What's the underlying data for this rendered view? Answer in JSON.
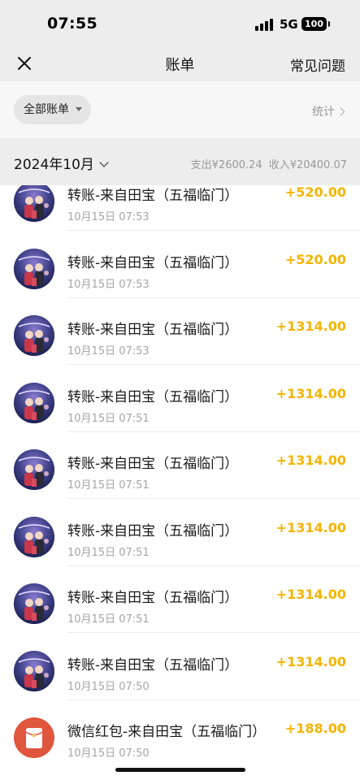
{
  "status_bar": {
    "time": "07:55",
    "network": "5G",
    "battery": "100"
  },
  "nav": {
    "title": "账单",
    "faq_label": "常见问题"
  },
  "filter": {
    "all_bills_label": "全部账单",
    "stats_label": "统计"
  },
  "month": {
    "label": "2024年10月",
    "expense_summary": "支出¥2600.24",
    "income_summary": "收入¥20400.07"
  },
  "transactions": [
    {
      "title": "转账-来自田宝（五福临门）",
      "time": "10月15日 07:53",
      "amount": "+520.00",
      "avatar": "disney-photo"
    },
    {
      "title": "转账-来自田宝（五福临门）",
      "time": "10月15日 07:53",
      "amount": "+520.00",
      "avatar": "disney-photo"
    },
    {
      "title": "转账-来自田宝（五福临门）",
      "time": "10月15日 07:53",
      "amount": "+1314.00",
      "avatar": "disney-photo"
    },
    {
      "title": "转账-来自田宝（五福临门）",
      "time": "10月15日 07:51",
      "amount": "+1314.00",
      "avatar": "disney-photo"
    },
    {
      "title": "转账-来自田宝（五福临门）",
      "time": "10月15日 07:51",
      "amount": "+1314.00",
      "avatar": "disney-photo"
    },
    {
      "title": "转账-来自田宝（五福临门）",
      "time": "10月15日 07:51",
      "amount": "+1314.00",
      "avatar": "disney-photo"
    },
    {
      "title": "转账-来自田宝（五福临门）",
      "time": "10月15日 07:51",
      "amount": "+1314.00",
      "avatar": "disney-photo"
    },
    {
      "title": "转账-来自田宝（五福临门）",
      "time": "10月15日 07:50",
      "amount": "+1314.00",
      "avatar": "disney-photo"
    },
    {
      "title": "微信红包-来自田宝（五福临门）",
      "time": "10月15日 07:50",
      "amount": "+188.00",
      "avatar": "red-packet"
    }
  ],
  "colors": {
    "income_amount": "#f4b400",
    "header_bg": "#ededed",
    "red_packet": "#e0553e"
  }
}
